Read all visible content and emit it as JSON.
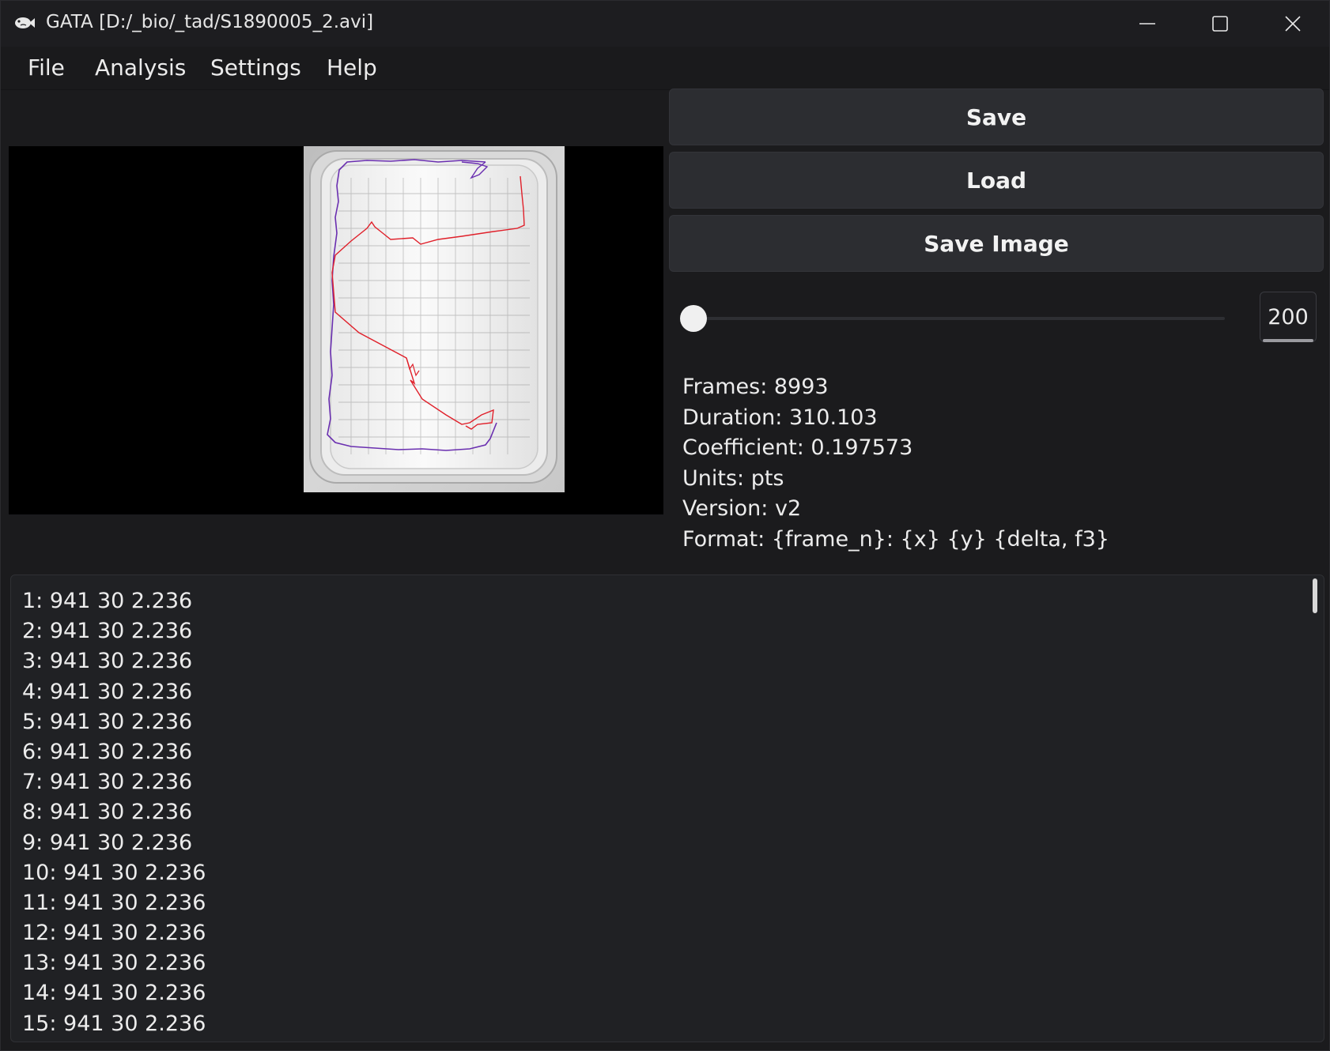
{
  "window": {
    "title": "GATA [D:/_bio/_tad/S1890005_2.avi]",
    "icon": "fish-icon"
  },
  "menu": [
    "File",
    "Analysis",
    "Settings",
    "Help"
  ],
  "buttons": {
    "save": "Save",
    "load": "Load",
    "save_image": "Save Image"
  },
  "slider": {
    "value": 200,
    "value_label": "200"
  },
  "info": [
    "Frames: 8993",
    "Duration: 310.103",
    "Coefficient: 0.197573",
    "Units: pts",
    "Version: v2",
    "Format: {frame_n}: {x} {y} {delta, f3}"
  ],
  "log": [
    "1: 941 30 2.236",
    "2: 941 30 2.236",
    "3: 941 30 2.236",
    "4: 941 30 2.236",
    "5: 941 30 2.236",
    "6: 941 30 2.236",
    "7: 941 30 2.236",
    "8: 941 30 2.236",
    "9: 941 30 2.236",
    "10: 941 30 2.236",
    "11: 941 30 2.236",
    "12: 941 30 2.236",
    "13: 941 30 2.236",
    "14: 941 30 2.236",
    "15: 941 30 2.236"
  ],
  "colors": {
    "track_purple": "#6a2fb0",
    "track_red": "#e0202a",
    "accent_thumb": "#f0f0f0"
  }
}
